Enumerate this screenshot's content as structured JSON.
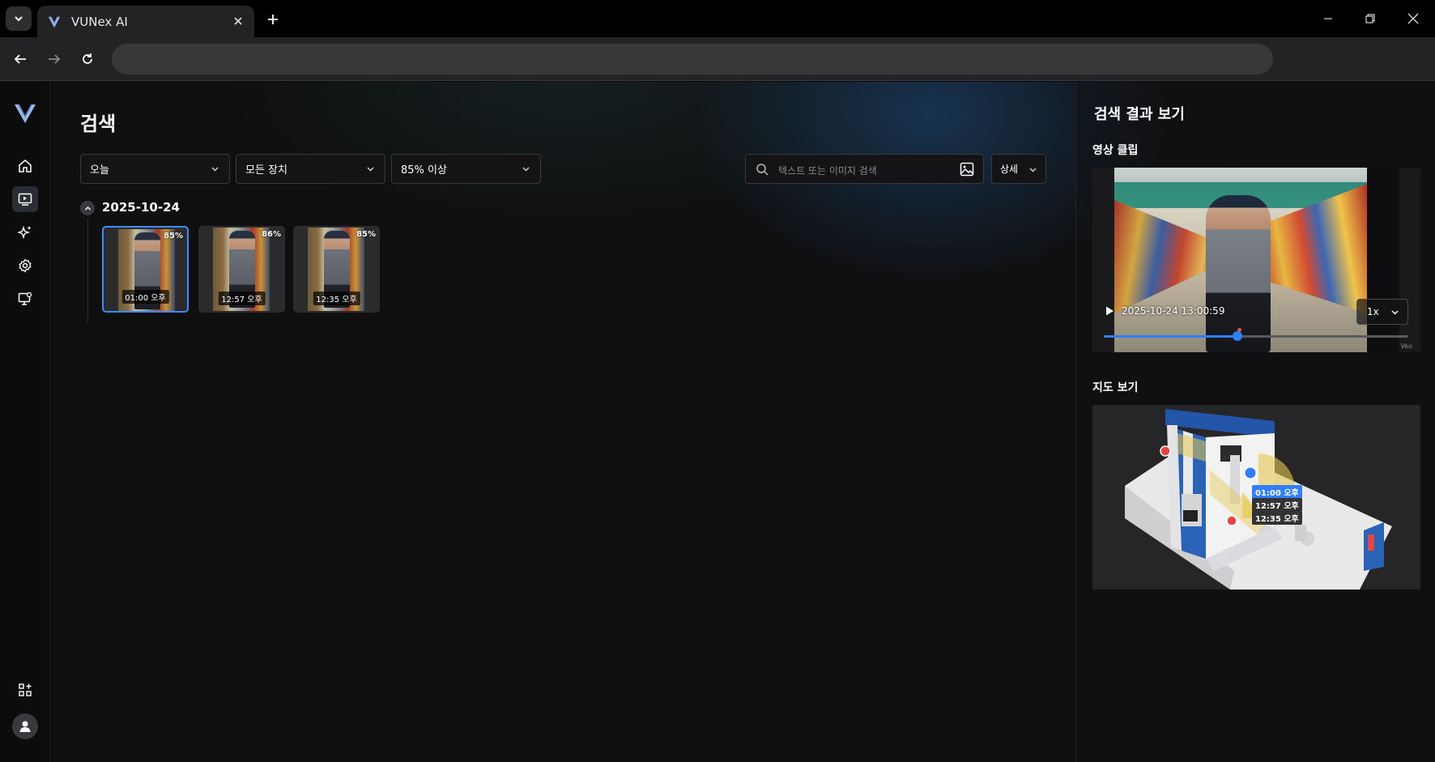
{
  "browser": {
    "tab_title": "VUNex AI",
    "address": ""
  },
  "page": {
    "title": "검색",
    "filters": {
      "date": "오늘",
      "device": "모든 장치",
      "threshold": "85% 이상"
    },
    "search": {
      "placeholder": "텍스트 또는 이미지 검색"
    },
    "detail_label": "상세",
    "group": {
      "date": "2025-10-24",
      "results": [
        {
          "time": "01:00 오후",
          "score": "85%"
        },
        {
          "time": "12:57 오후",
          "score": "86%"
        },
        {
          "time": "12:35 오후",
          "score": "85%"
        }
      ]
    }
  },
  "side": {
    "title": "검색 결과 보기",
    "clip_section": "영상 클립",
    "player": {
      "timestamp": "2025-10-24 13:00:59",
      "speed": "1x",
      "progress": 0.44,
      "marker": 0.443,
      "watermark": "Veo"
    },
    "map_section": "지도 보기",
    "map_labels": [
      "01:00 오후",
      "12:57 오후",
      "12:35 오후"
    ]
  },
  "icons": {
    "rail": [
      "logo-icon",
      "home-icon",
      "video-search-icon",
      "sparkle-ai-icon",
      "settings-icon",
      "monitor-settings-icon",
      "apps-add-icon",
      "user-avatar-icon"
    ]
  },
  "colors": {
    "accent": "#2f7fff",
    "selection": "#3d8bfd",
    "marker": "#e54444"
  }
}
